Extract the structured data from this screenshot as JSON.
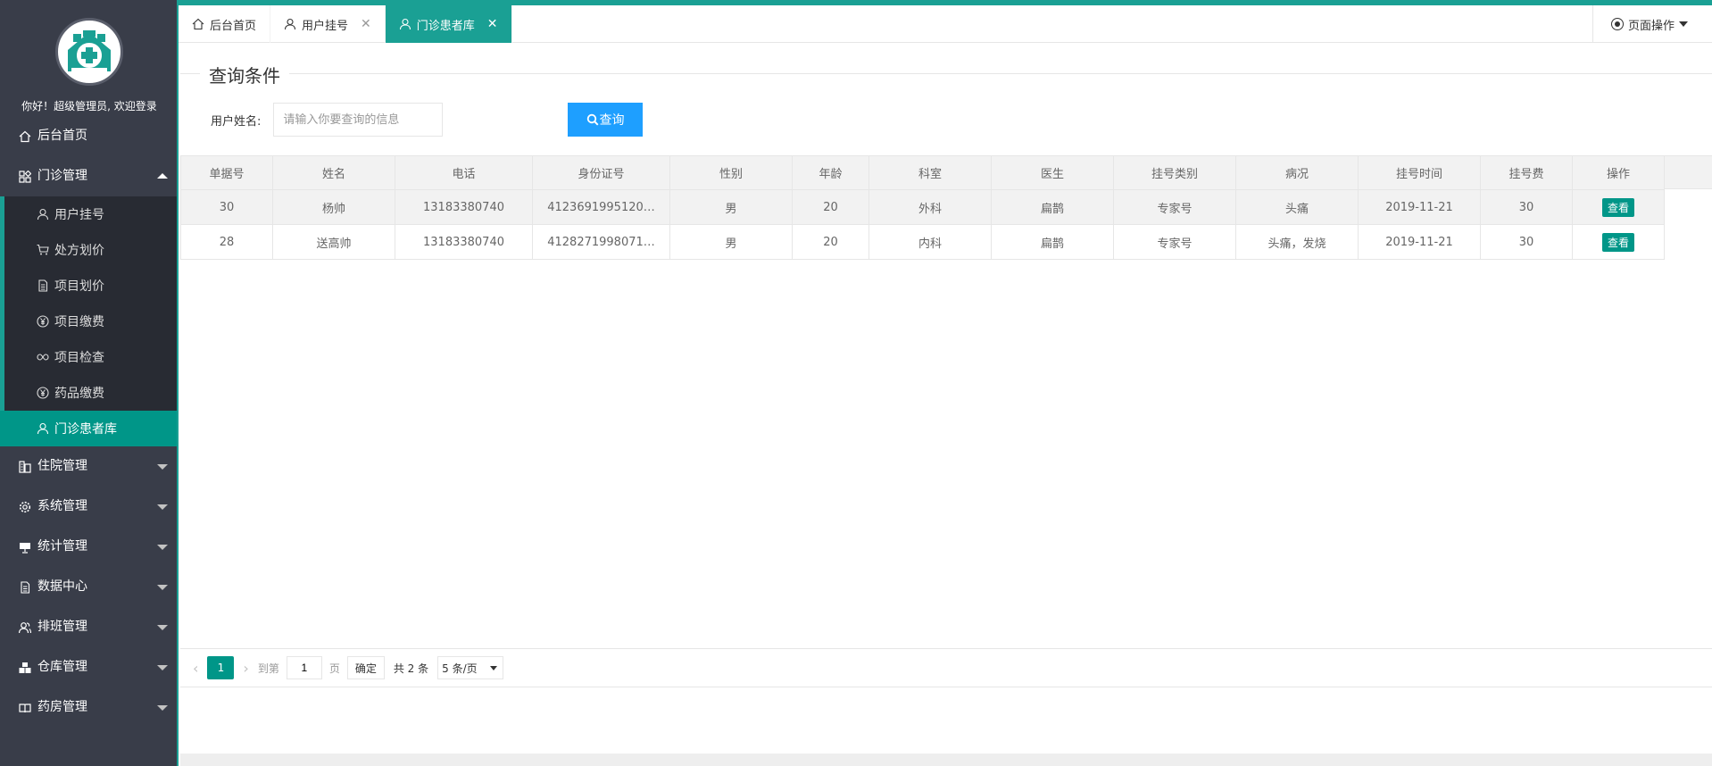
{
  "app": {
    "welcome": "你好！超级管理员, 欢迎登录"
  },
  "colors": {
    "sidebar_bg": "#393D49",
    "submenu_bg": "#282B33",
    "accent": "#1AA094",
    "active_green": "#009688",
    "search_blue": "#1E9FFF"
  },
  "sidebar": {
    "home": "后台首页",
    "clinic": {
      "label": "门诊管理",
      "items": [
        {
          "label": "用户挂号",
          "icon": "user-icon"
        },
        {
          "label": "处方划价",
          "icon": "cart-icon"
        },
        {
          "label": "项目划价",
          "icon": "document-icon"
        },
        {
          "label": "项目缴费",
          "icon": "yen-icon"
        },
        {
          "label": "项目检查",
          "icon": "link-icon"
        },
        {
          "label": "药品缴费",
          "icon": "yen-icon"
        },
        {
          "label": "门诊患者库",
          "icon": "user-icon"
        }
      ]
    },
    "groups": [
      {
        "label": "住院管理",
        "icon": "building-icon"
      },
      {
        "label": "系统管理",
        "icon": "gear-icon"
      },
      {
        "label": "统计管理",
        "icon": "chart-icon"
      },
      {
        "label": "数据中心",
        "icon": "document-icon"
      },
      {
        "label": "排班管理",
        "icon": "users-icon"
      },
      {
        "label": "仓库管理",
        "icon": "warehouse-icon"
      },
      {
        "label": "药房管理",
        "icon": "book-icon"
      }
    ]
  },
  "tabs": [
    {
      "label": "后台首页",
      "icon": "home-icon",
      "closable": false
    },
    {
      "label": "用户挂号",
      "icon": "user-icon",
      "closable": true
    },
    {
      "label": "门诊患者库",
      "icon": "user-icon",
      "closable": true,
      "active": true
    }
  ],
  "page_ops": "页面操作",
  "query": {
    "legend": "查询条件",
    "label": "用户姓名:",
    "placeholder": "请输入你要查询的信息",
    "button": "查询"
  },
  "table": {
    "headers": [
      "单据号",
      "姓名",
      "电话",
      "身份证号",
      "性别",
      "年龄",
      "科室",
      "医生",
      "挂号类别",
      "病况",
      "挂号时间",
      "挂号费",
      "操作"
    ],
    "rows": [
      [
        "30",
        "杨帅",
        "13183380740",
        "4123691995120…",
        "男",
        "20",
        "外科",
        "扁鹊",
        "专家号",
        "头痛",
        "2019-11-21",
        "30",
        "查看"
      ],
      [
        "28",
        "送高帅",
        "13183380740",
        "4128271998071…",
        "男",
        "20",
        "内科",
        "扁鹊",
        "专家号",
        "头痛，发烧",
        "2019-11-21",
        "30",
        "查看"
      ]
    ]
  },
  "pager": {
    "current": "1",
    "goto_label": "到第",
    "goto_value": "1",
    "page_label": "页",
    "confirm": "确定",
    "total": "共 2 条",
    "per_page": "5 条/页"
  }
}
